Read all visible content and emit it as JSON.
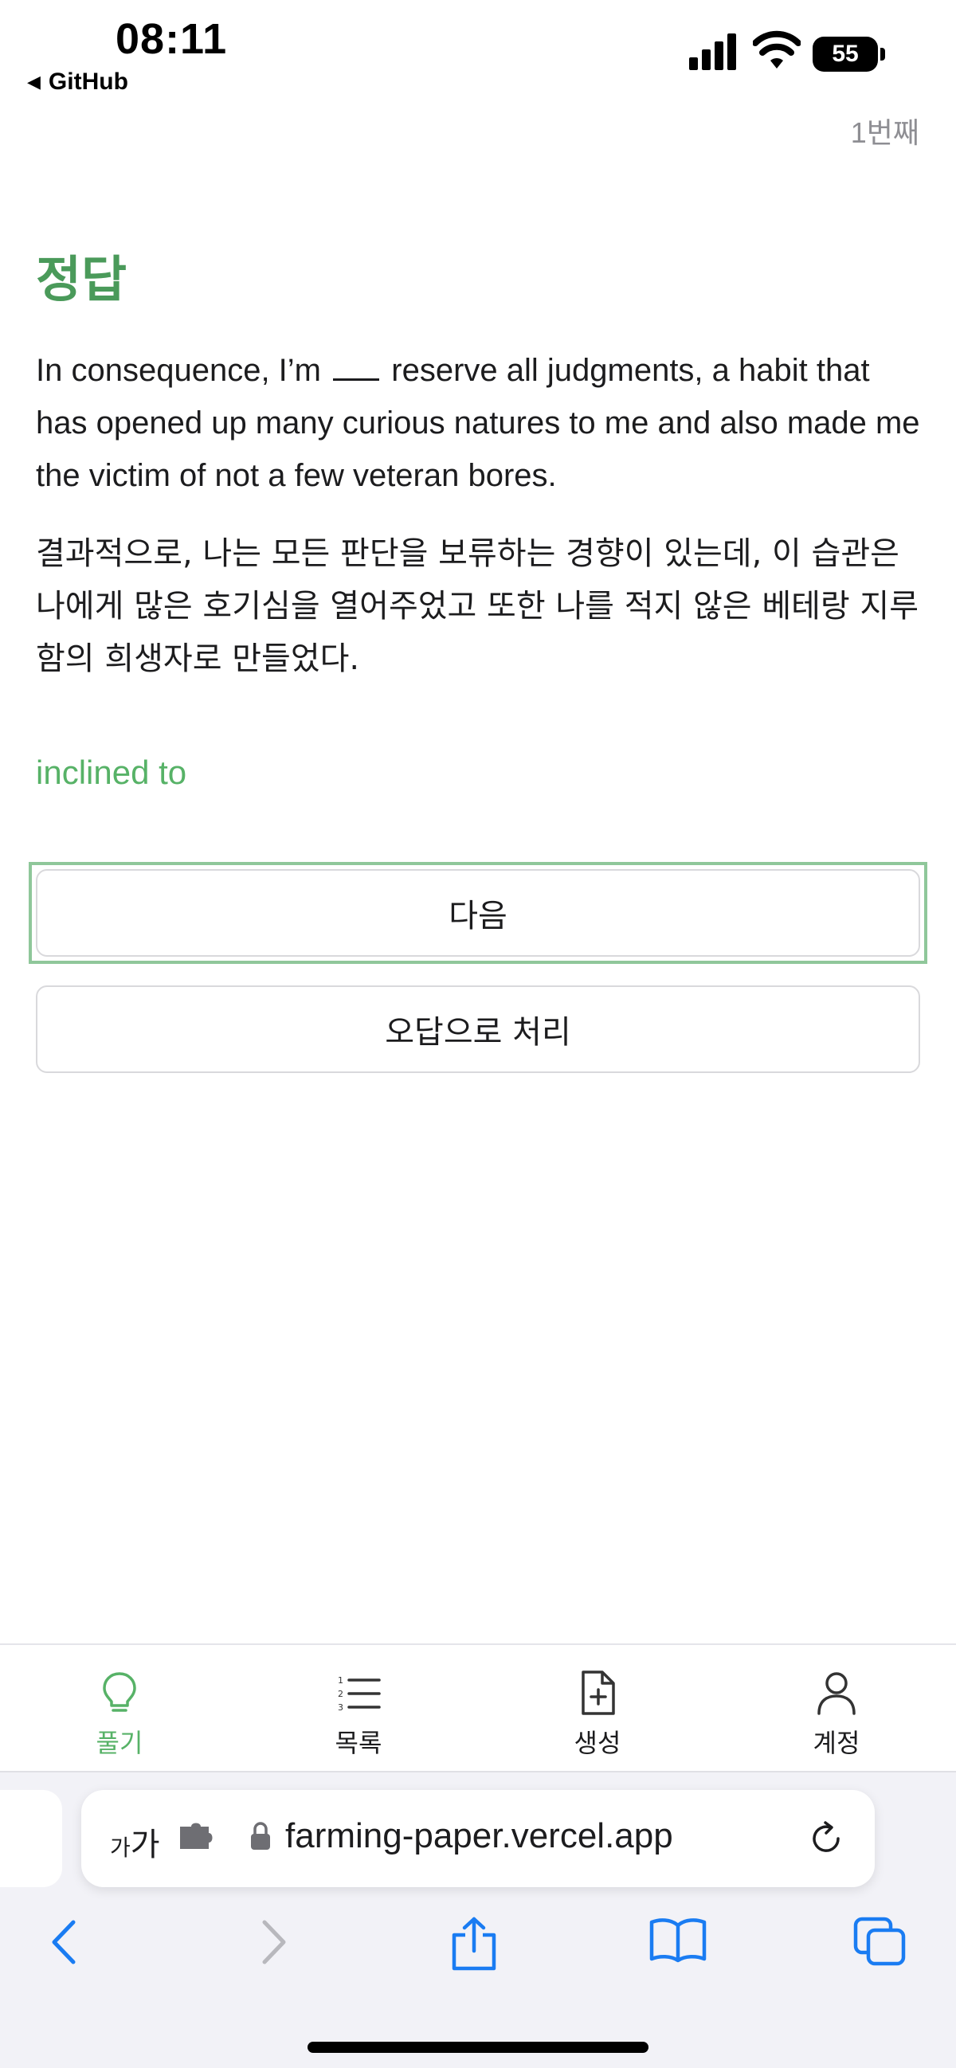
{
  "status": {
    "time": "08:11",
    "back_app": "GitHub",
    "battery": "55"
  },
  "quiz": {
    "counter": "1번째",
    "title": "정답",
    "sentence_before": "In consequence, I’m",
    "sentence_after": "reserve all judgments, a habit that has opened up many curious natures to me and also made me the victim of not a few veteran bores.",
    "translation": "결과적으로, 나는 모든 판단을 보류하는 경향이 있는데, 이 습관은 나에게 많은 호기심을 열어주었고 또한 나를 적지 않은 베테랑 지루함의 희생자로 만들었다.",
    "answer": "inclined to",
    "next_label": "다음",
    "mark_wrong_label": "오답으로 처리",
    "accent_color": "#57b267"
  },
  "tabbar": {
    "items": [
      {
        "label": "풀기",
        "icon": "lightbulb-icon",
        "active": true
      },
      {
        "label": "목록",
        "icon": "numbered-list-icon",
        "active": false
      },
      {
        "label": "생성",
        "icon": "file-plus-icon",
        "active": false
      },
      {
        "label": "계정",
        "icon": "user-icon",
        "active": false
      }
    ]
  },
  "browser": {
    "aa_small": "가",
    "aa_large": "가",
    "url": "farming-paper.vercel.app"
  }
}
